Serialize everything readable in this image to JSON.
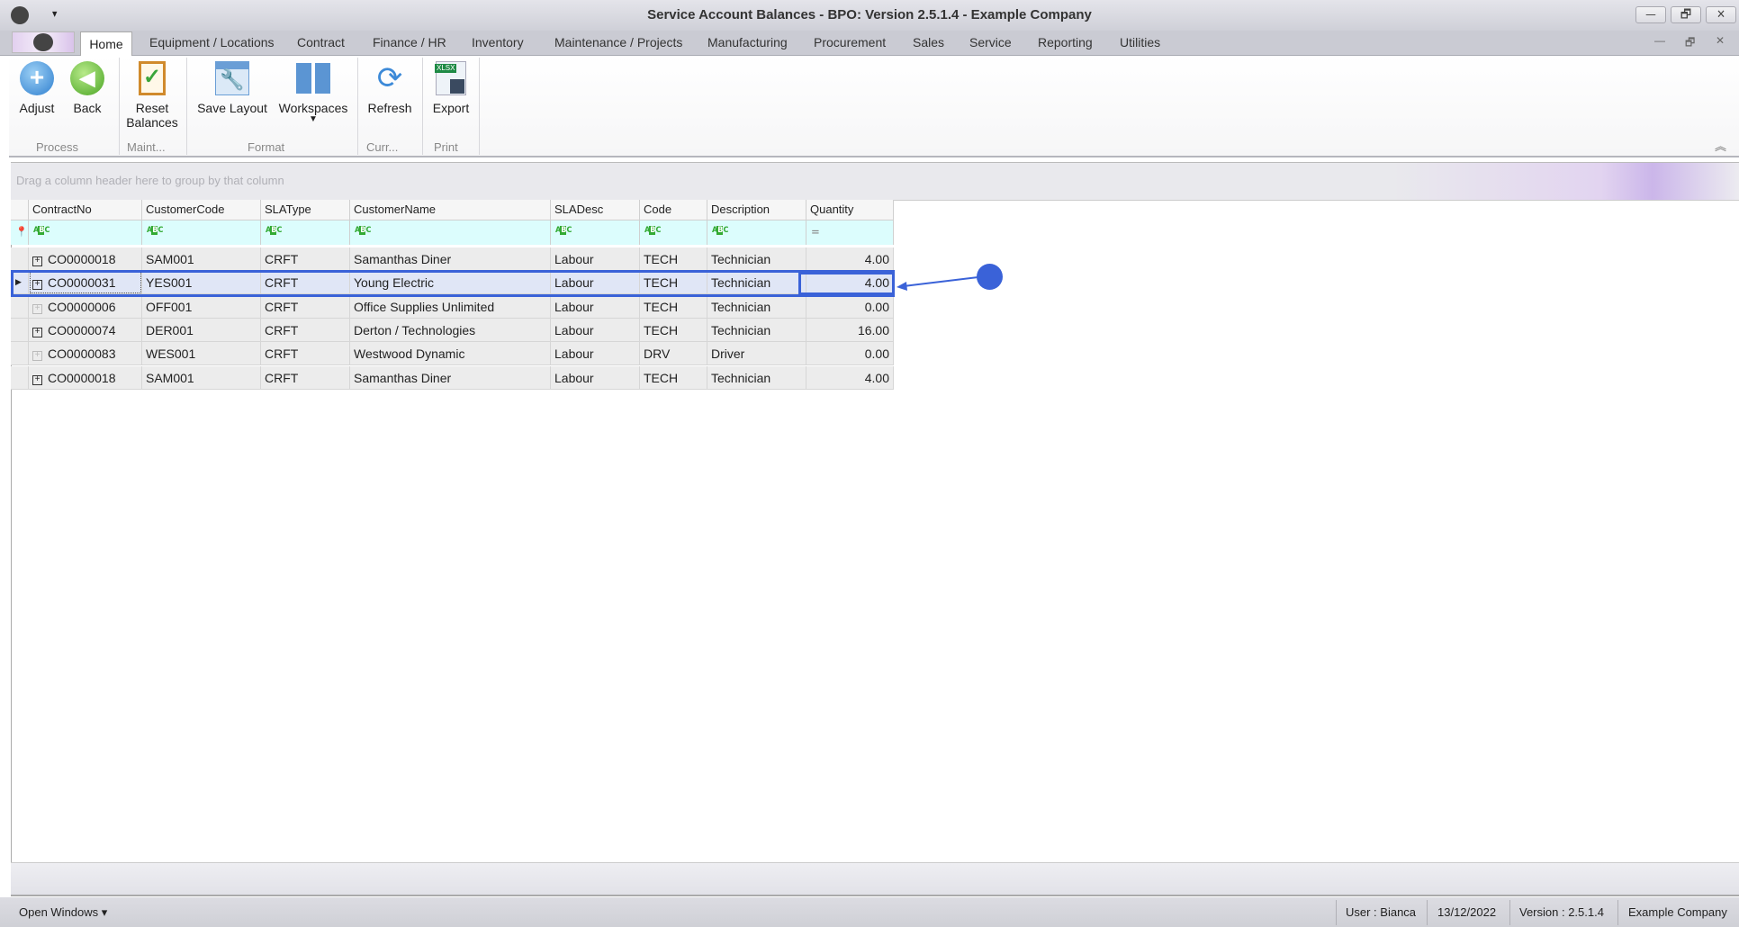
{
  "window": {
    "title_prefix": "Service Account Balances",
    "title_suffix": " - BPO: Version 2.5.1.4 - Example Company",
    "minimize": "—",
    "restore": "🗗",
    "close": "✕"
  },
  "tabs": [
    "Home",
    "Equipment / Locations",
    "Contract",
    "Finance / HR",
    "Inventory",
    "Maintenance / Projects",
    "Manufacturing",
    "Procurement",
    "Sales",
    "Service",
    "Reporting",
    "Utilities"
  ],
  "ribbon": {
    "buttons": {
      "adjust": "Adjust",
      "back": "Back",
      "reset1": "Reset",
      "reset2": "Balances",
      "save_layout": "Save Layout",
      "workspaces": "Workspaces",
      "refresh": "Refresh",
      "export": "Export",
      "xlsx": "XLSX"
    },
    "groups": {
      "process": "Process",
      "maint": "Maint...",
      "format": "Format",
      "curr": "Curr...",
      "print": "Print"
    }
  },
  "grid": {
    "group_panel": "Drag a column header here to group by that column",
    "columns": [
      "ContractNo",
      "CustomerCode",
      "SLAType",
      "CustomerName",
      "SLADesc",
      "Code",
      "Description",
      "Quantity"
    ],
    "rows": [
      [
        "CO0000018",
        "SAM001",
        "CRFT",
        "Samanthas Diner",
        "Labour",
        "TECH",
        "Technician",
        "4.00"
      ],
      [
        "CO0000031",
        "YES001",
        "CRFT",
        "Young Electric",
        "Labour",
        "TECH",
        "Technician",
        "4.00"
      ],
      [
        "CO0000006",
        "OFF001",
        "CRFT",
        "Office Supplies Unlimited",
        "Labour",
        "TECH",
        "Technician",
        "0.00"
      ],
      [
        "CO0000074",
        "DER001",
        "CRFT",
        "Derton / Technologies",
        "Labour",
        "TECH",
        "Technician",
        "16.00"
      ],
      [
        "CO0000083",
        "WES001",
        "CRFT",
        "Westwood Dynamic",
        "Labour",
        "DRV",
        "Driver",
        "0.00"
      ],
      [
        "CO0000018",
        "SAM001",
        "CRFT",
        "Samanthas Diner",
        "Labour",
        "TECH",
        "Technician",
        "4.00"
      ]
    ],
    "expandable": [
      true,
      true,
      false,
      true,
      false,
      true
    ],
    "selected_row": 1
  },
  "status": {
    "open_windows": "Open Windows ▾",
    "user": "User : Bianca",
    "date": "13/12/2022",
    "version": "Version : 2.5.1.4",
    "company": "Example Company"
  },
  "colors": {
    "accent": "#3a62d8"
  }
}
